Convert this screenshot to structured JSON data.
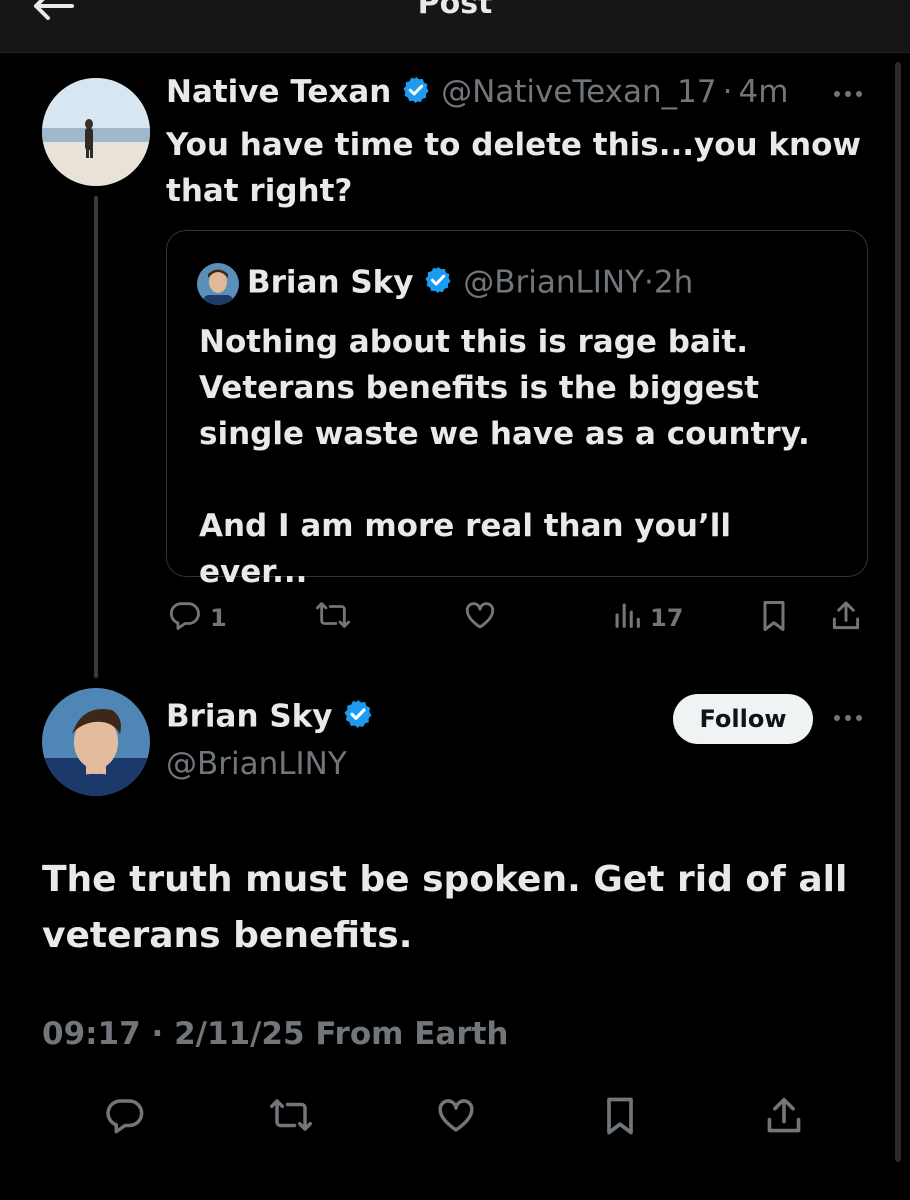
{
  "header": {
    "title": "Post"
  },
  "reply": {
    "author_name": "Native Texan",
    "handle": "@NativeTexan_17",
    "time": "4m",
    "text": "You have time to delete this...you know that right?",
    "quoted": {
      "author_name": "Brian Sky",
      "handle": "@BrianLINY",
      "time": "2h",
      "text": "Nothing about this is rage bait. Veterans benefits is the biggest single waste we have as a country.\n\nAnd I am more real than you’ll ever..."
    },
    "stats": {
      "replies": "1",
      "views": "17"
    }
  },
  "main_post": {
    "author_name": "Brian Sky",
    "handle": "@BrianLINY",
    "follow_label": "Follow",
    "text": "The truth must be spoken. Get rid of all veterans benefits.",
    "time": "09:17",
    "date": "2/11/25",
    "location": "From Earth"
  },
  "colors": {
    "background": "#000000",
    "text": "#e7e9ea",
    "muted": "#71767b",
    "verified": "#1d9bf0",
    "border": "#2f3336"
  },
  "icons": [
    "back-arrow-icon",
    "verified-icon",
    "more-icon",
    "reply-icon",
    "repost-icon",
    "like-icon",
    "views-icon",
    "bookmark-icon",
    "share-icon"
  ]
}
